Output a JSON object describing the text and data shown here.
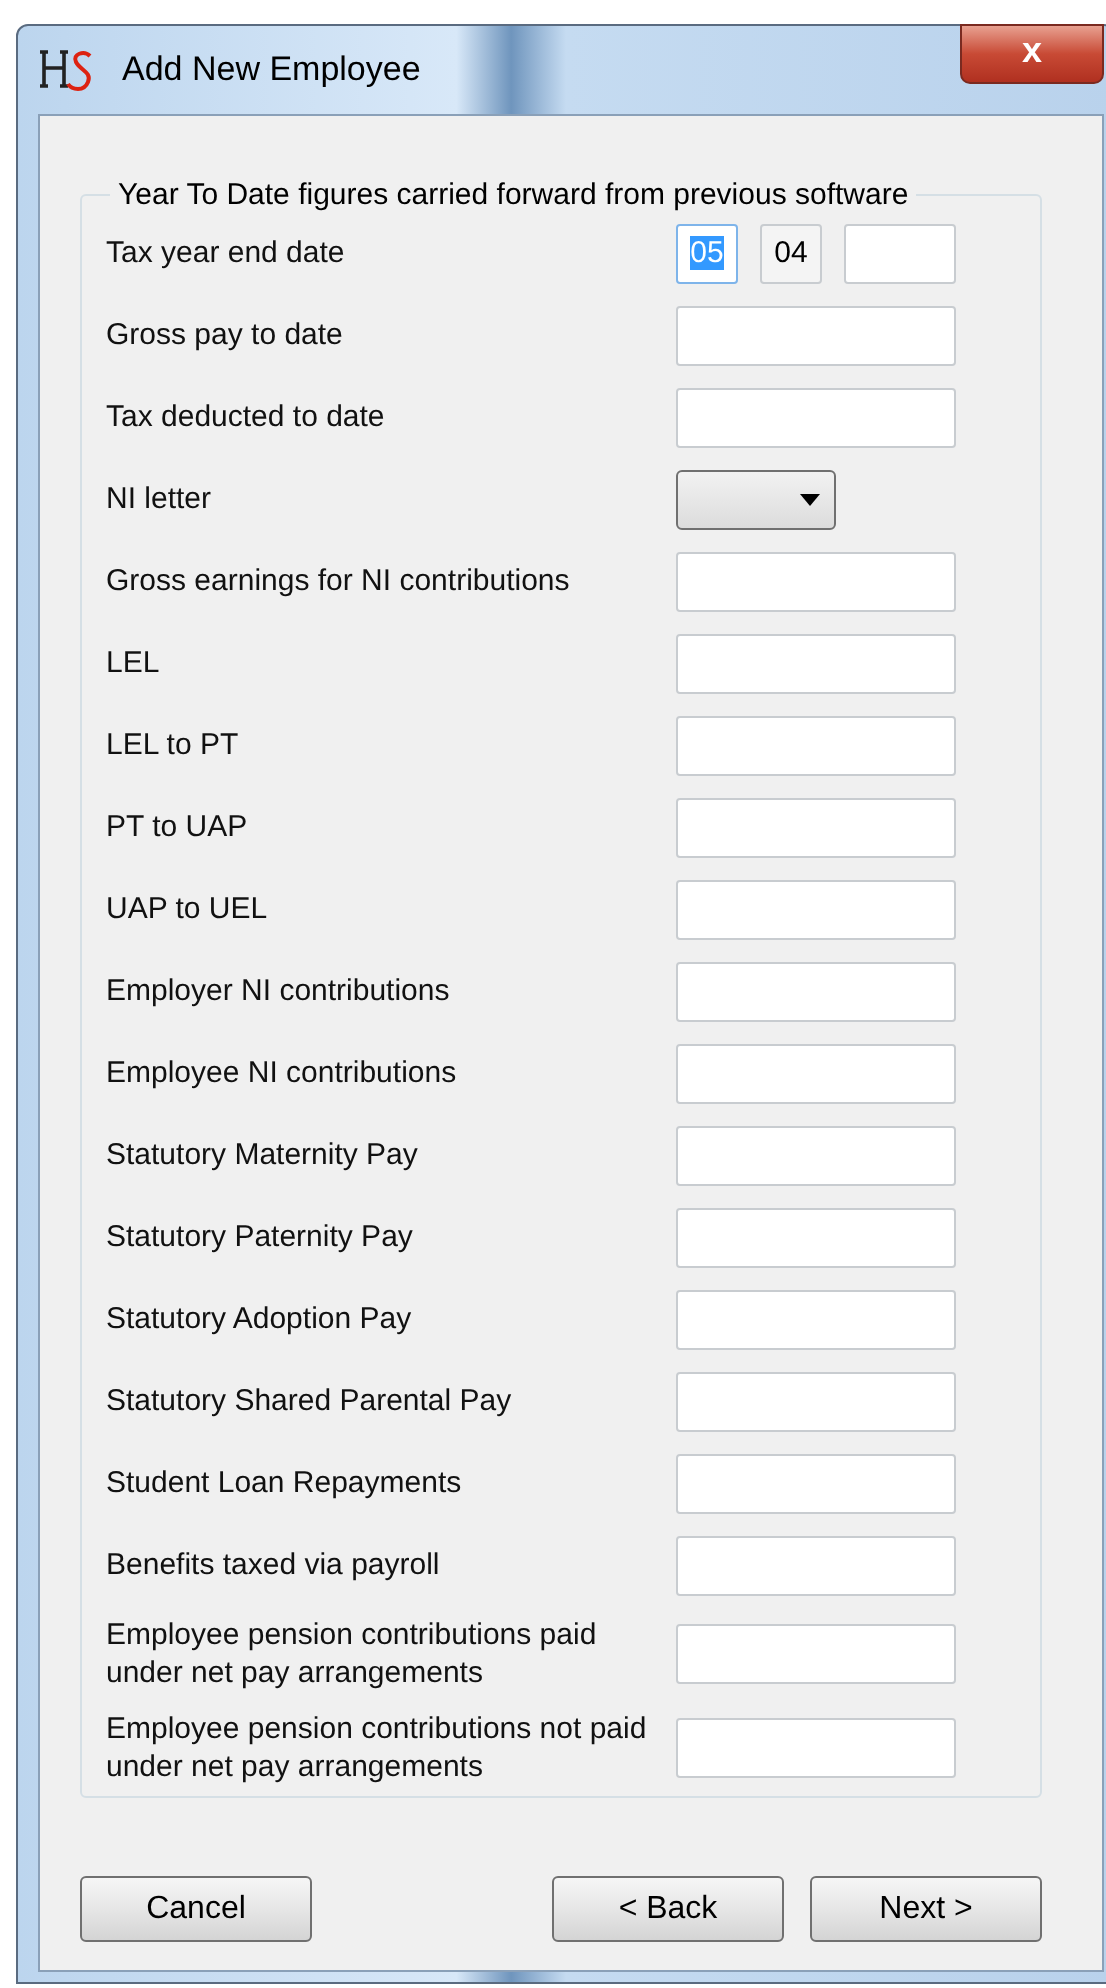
{
  "window": {
    "title": "Add New Employee",
    "close_label": "x"
  },
  "group": {
    "title": "Year To Date figures carried forward from previous software"
  },
  "rows": [
    {
      "kind": "date",
      "label": "Tax year end date",
      "fields": [
        {
          "value": "05",
          "selected": true
        },
        {
          "value": "04",
          "selected": false
        },
        {
          "selected": false
        }
      ]
    },
    {
      "kind": "text",
      "label": "Gross pay to date"
    },
    {
      "kind": "text",
      "label": "Tax deducted to date"
    },
    {
      "kind": "dropdown",
      "label": "NI letter"
    },
    {
      "kind": "text",
      "label": "Gross earnings for NI contributions"
    },
    {
      "kind": "text",
      "label": "LEL"
    },
    {
      "kind": "text",
      "label": "LEL to PT"
    },
    {
      "kind": "text",
      "label": "PT to UAP"
    },
    {
      "kind": "text",
      "label": "UAP to UEL"
    },
    {
      "kind": "text",
      "label": "Employer NI contributions"
    },
    {
      "kind": "text",
      "label": "Employee NI contributions"
    },
    {
      "kind": "text",
      "label": "Statutory Maternity Pay"
    },
    {
      "kind": "text",
      "label": "Statutory Paternity Pay"
    },
    {
      "kind": "text",
      "label": "Statutory Adoption Pay"
    },
    {
      "kind": "text",
      "label": "Statutory Shared Parental Pay"
    },
    {
      "kind": "text",
      "label": "Student Loan Repayments"
    },
    {
      "kind": "text",
      "label": "Benefits taxed via payroll"
    },
    {
      "kind": "text",
      "label": "Employee pension contributions paid under net pay arrangements"
    },
    {
      "kind": "text",
      "label": "Employee pension contributions not paid under net pay arrangements"
    }
  ],
  "buttons": [
    {
      "label": "Cancel",
      "kind": "left"
    },
    {
      "label": "< Back",
      "kind": "right"
    },
    {
      "label": "Next >",
      "kind": "right"
    }
  ]
}
